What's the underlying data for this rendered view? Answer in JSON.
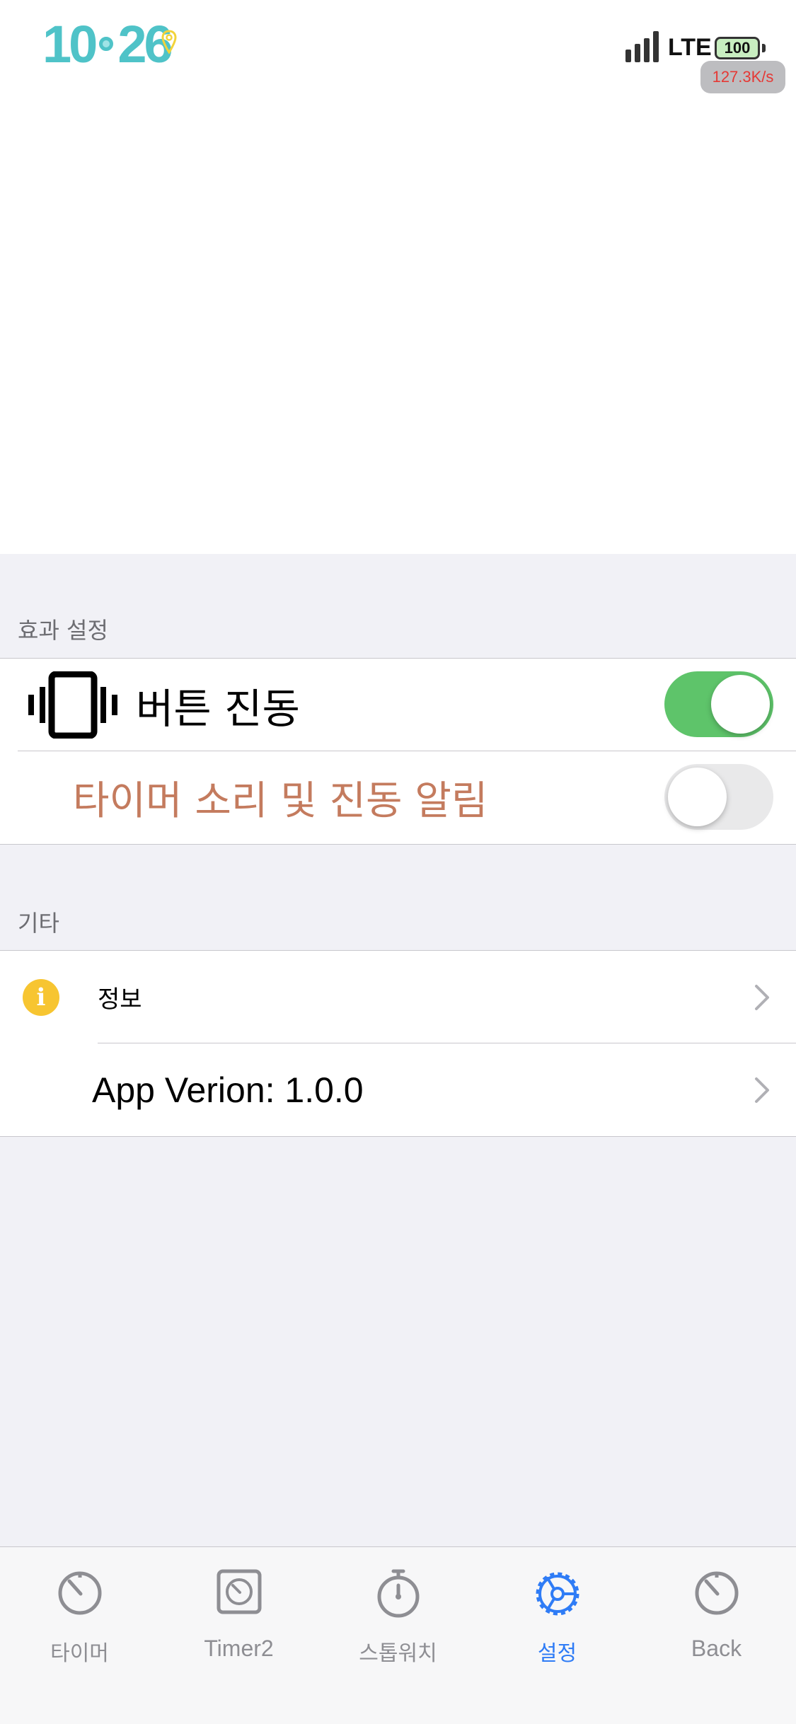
{
  "status_bar": {
    "time_hour": "10",
    "time_min": "26",
    "network": "LTE",
    "battery": "100",
    "speed": "127.3K/s"
  },
  "colors": {
    "accent": "#2f7cf6",
    "toggle_on": "#5ec46a",
    "alert_label": "#c47b5e",
    "info_icon": "#f7c531"
  },
  "sections": {
    "effects": {
      "header": "효과 설정",
      "button_vibration": {
        "label": "버튼 진동",
        "icon": "vibration-icon",
        "enabled": true
      },
      "timer_alert": {
        "label": "타이머 소리 및 진동 알림",
        "enabled": false
      }
    },
    "other": {
      "header": "기타",
      "info": {
        "label": "정보",
        "icon": "info-icon"
      },
      "version": {
        "label": "App Verion: 1.0.0"
      }
    }
  },
  "tabbar": {
    "tabs": [
      {
        "label": "타이머",
        "icon": "timer-icon",
        "active": false
      },
      {
        "label": "Timer2",
        "icon": "timer2-icon",
        "active": false
      },
      {
        "label": "스톱워치",
        "icon": "stopwatch-icon",
        "active": false
      },
      {
        "label": "설정",
        "icon": "gear-icon",
        "active": true
      },
      {
        "label": "Back",
        "icon": "back-timer-icon",
        "active": false
      }
    ]
  }
}
